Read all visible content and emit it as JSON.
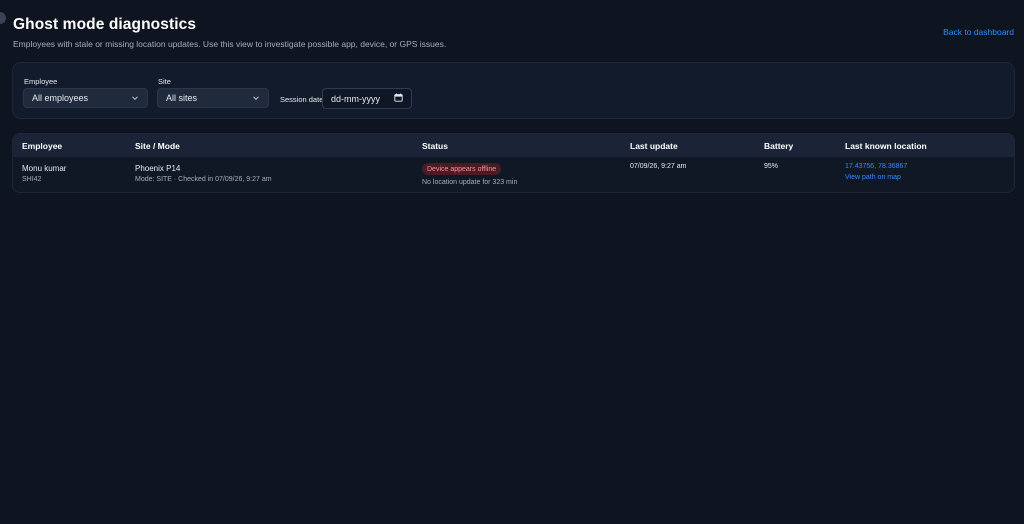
{
  "header": {
    "title": "Ghost mode diagnostics",
    "subtitle": "Employees with stale or missing location updates. Use this view to investigate possible app, device, or GPS issues.",
    "back_link": "Back to dashboard"
  },
  "filters": {
    "employee_label": "Employee",
    "employee_value": "All employees",
    "site_label": "Site",
    "site_value": "All sites",
    "session_date_label": "Session date",
    "session_date_placeholder": "dd-mm-yyyy"
  },
  "table": {
    "columns": [
      "Employee",
      "Site / Mode",
      "Status",
      "Last update",
      "Battery",
      "Last known location"
    ],
    "rows": [
      {
        "employee_name": "Monu kumar",
        "employee_id": "SHI42",
        "site": "Phoenix P14",
        "mode": "Mode: SITE · Checked in 07/09/26, 9:27 am",
        "status_badge": "Device appears offline",
        "status_detail": "No location update for 323 min",
        "last_update": "07/09/26, 9:27 am",
        "battery": "95%",
        "coords": "17.43756, 78.36867",
        "map_link": "View path on map"
      }
    ]
  },
  "colors": {
    "accent": "#2f8bff",
    "danger_bg": "#4a1b22",
    "danger_text": "#ff8f99",
    "background": "#0f1520"
  },
  "icons": [
    "chevron-down-icon",
    "calendar-icon"
  ]
}
